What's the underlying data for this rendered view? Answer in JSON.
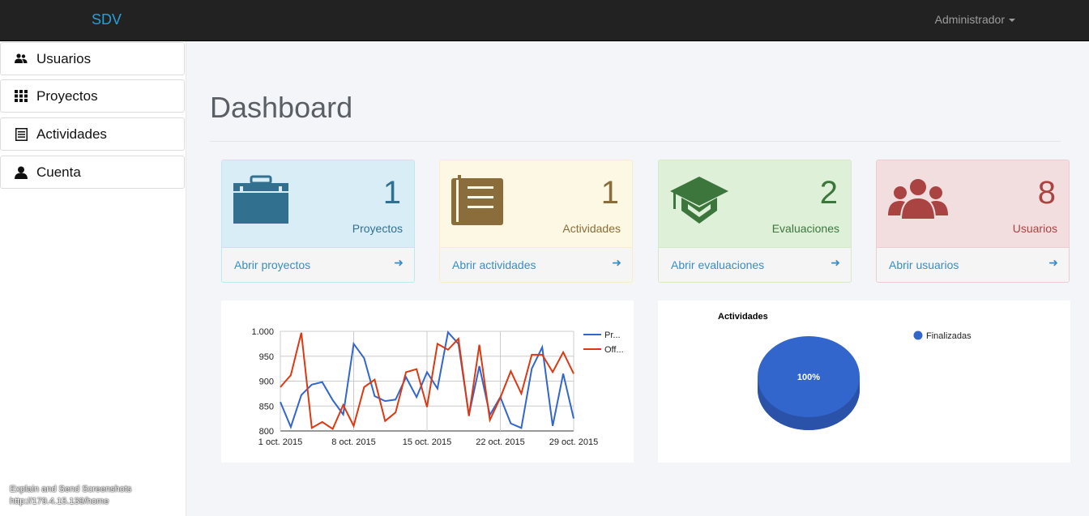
{
  "navbar": {
    "brand": "SDV",
    "user": "Administrador"
  },
  "sidebar": {
    "items": [
      {
        "label": "Usuarios",
        "icon": "users-icon"
      },
      {
        "label": "Proyectos",
        "icon": "grid-icon"
      },
      {
        "label": "Actividades",
        "icon": "list-icon"
      },
      {
        "label": "Cuenta",
        "icon": "user-icon"
      }
    ]
  },
  "page": {
    "title": "Dashboard"
  },
  "cards": [
    {
      "count": "1",
      "caption": "Proyectos",
      "link": "Abrir proyectos",
      "icon": "briefcase-icon",
      "accent": "#31708f"
    },
    {
      "count": "1",
      "caption": "Actividades",
      "link": "Abrir actividades",
      "icon": "book-icon",
      "accent": "#8a6d3b"
    },
    {
      "count": "2",
      "caption": "Evaluaciones",
      "link": "Abrir evaluaciones",
      "icon": "graduation-cap-icon",
      "accent": "#3c763d"
    },
    {
      "count": "8",
      "caption": "Usuarios",
      "link": "Abrir usuarios",
      "icon": "group-icon",
      "accent": "#a94442"
    }
  ],
  "footer_note": {
    "line1": "Explain and Send Screenshots",
    "line2": "http://179.4.15.139/home"
  },
  "chart_data": [
    {
      "type": "line",
      "x_labels": [
        "1 oct. 2015",
        "8 oct. 2015",
        "15 oct. 2015",
        "22 oct. 2015",
        "29 oct. 2015"
      ],
      "y_ticks": [
        "800",
        "850",
        "900",
        "950",
        "1.000"
      ],
      "ylim": [
        800,
        1000
      ],
      "grid": true,
      "legend": "right",
      "series": [
        {
          "name": "Pr...",
          "color": "#3366cc",
          "values": [
            858,
            808,
            872,
            893,
            898,
            862,
            833,
            975,
            946,
            870,
            860,
            863,
            908,
            868,
            918,
            885,
            998,
            975,
            832,
            930,
            832,
            868,
            815,
            806,
            925,
            968,
            810,
            915,
            825
          ]
        },
        {
          "name": "Off...",
          "color": "#dc3912",
          "values": [
            888,
            912,
            997,
            806,
            818,
            804,
            852,
            810,
            888,
            903,
            820,
            837,
            918,
            924,
            848,
            975,
            963,
            985,
            830,
            973,
            822,
            867,
            920,
            875,
            953,
            953,
            918,
            958,
            915
          ]
        }
      ]
    },
    {
      "type": "pie",
      "title": "Actividades",
      "legend": "right",
      "slices": [
        {
          "label": "Finalizadas",
          "value": 100,
          "display": "100%",
          "color": "#3366cc"
        }
      ]
    }
  ]
}
